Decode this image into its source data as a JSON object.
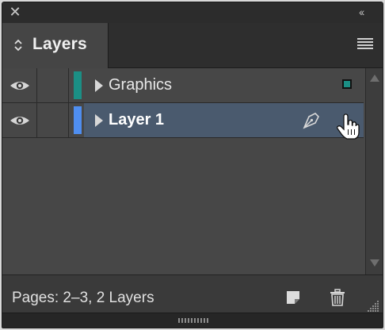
{
  "panel": {
    "tab_label": "Layers",
    "close_glyph": "✕",
    "collapse_glyph": "‹‹"
  },
  "layers": [
    {
      "name": "Graphics",
      "visible": true,
      "color": "#1b8f85",
      "selected": false,
      "icon": "eye-icon"
    },
    {
      "name": "Layer 1",
      "visible": true,
      "color": "#4f8ef0",
      "selected": true,
      "icon": "eye-icon"
    }
  ],
  "footer": {
    "status": "Pages: 2–3, 2 Layers"
  },
  "colors": {
    "selection_row": "#4a5a6e",
    "panel_bg": "#474747",
    "graphics_indicator": "#1b8f85"
  }
}
